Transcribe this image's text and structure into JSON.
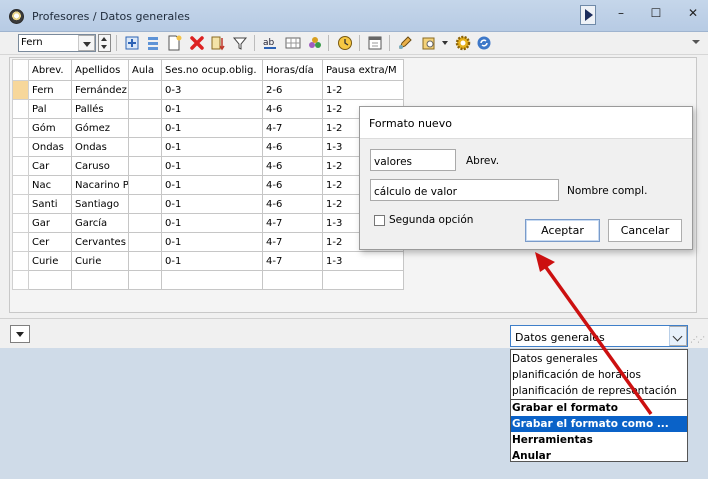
{
  "window": {
    "title": "Profesores / Datos generales",
    "icons": {
      "app": "clock-icon",
      "play": "play-icon",
      "minimize": "minimize-icon",
      "maximize": "maximize-icon",
      "close": "close-icon"
    },
    "min_glyph": "–",
    "max_glyph": "☐",
    "close_glyph": "✕"
  },
  "toolbar": {
    "selector_value": "Fern",
    "icons": [
      "new-row-icon",
      "list-icon",
      "new-doc-icon",
      "delete-icon",
      "sort-icon",
      "filter-icon",
      "text-ab-icon",
      "grid-icon",
      "link-icon",
      "clock-icon",
      "calendar-icon",
      "edit-icon",
      "settings-icon",
      "gear-icon",
      "sync-icon"
    ]
  },
  "grid": {
    "headers": [
      "Abrev.",
      "Apellidos",
      "Aula",
      "Ses.no ocup.oblig.",
      "Horas/día",
      "Pausa extra/M"
    ],
    "rows": [
      [
        "Fern",
        "Fernández",
        "",
        "0-3",
        "2-6",
        "1-2"
      ],
      [
        "Pal",
        "Pallés",
        "",
        "0-1",
        "4-6",
        "1-2"
      ],
      [
        "Góm",
        "Gómez",
        "",
        "0-1",
        "4-7",
        "1-2"
      ],
      [
        "Ondas",
        "Ondas",
        "",
        "0-1",
        "4-6",
        "1-3"
      ],
      [
        "Car",
        "Caruso",
        "",
        "0-1",
        "4-6",
        "1-2"
      ],
      [
        "Nac",
        "Nacarino P",
        "",
        "0-1",
        "4-6",
        "1-2"
      ],
      [
        "Santi",
        "Santiago",
        "",
        "0-1",
        "4-6",
        "1-2"
      ],
      [
        "Gar",
        "García",
        "",
        "0-1",
        "4-7",
        "1-3"
      ],
      [
        "Cer",
        "Cervantes",
        "",
        "0-1",
        "4-7",
        "1-2"
      ],
      [
        "Curie",
        "Curie",
        "",
        "0-1",
        "4-7",
        "1-3"
      ]
    ],
    "selected_row": 0
  },
  "format_select": {
    "value": "Datos generales",
    "options": [
      {
        "label": "Datos generales",
        "bold": false
      },
      {
        "label": "planificación de horarios",
        "bold": false
      },
      {
        "label": "planificación de representación",
        "bold": false
      },
      {
        "label": "Grabar el formato",
        "bold": true
      },
      {
        "label": "Grabar el formato como ...",
        "bold": true,
        "highlighted": true
      },
      {
        "label": "Herramientas",
        "bold": true
      },
      {
        "label": "Anular",
        "bold": true
      }
    ]
  },
  "dialog": {
    "title": "Formato nuevo",
    "abrev_value": "valores",
    "abrev_label": "Abrev.",
    "fullname_value": "cálculo de valor",
    "fullname_label": "Nombre compl.",
    "second_option_label": "Segunda opción",
    "second_option_checked": false,
    "accept_label": "Aceptar",
    "cancel_label": "Cancelar"
  },
  "colors": {
    "titlebar": "#c5d6ea",
    "highlight": "#0a62c8",
    "selected_row_marker": "#f7d79a",
    "annotation_arrow": "#cc1010"
  }
}
